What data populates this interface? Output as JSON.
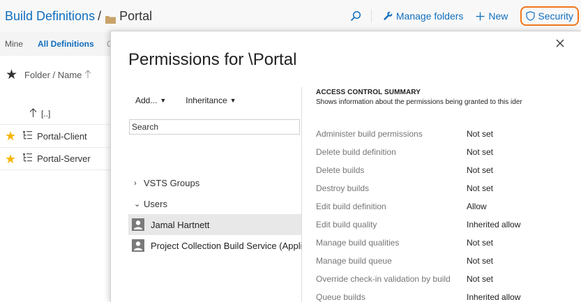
{
  "breadcrumb": {
    "root": "Build Definitions",
    "separator": "/",
    "current": "Portal"
  },
  "top_actions": {
    "manage_folders": "Manage folders",
    "new": "New",
    "security": "Security"
  },
  "tabs": {
    "mine": "Mine",
    "all_definitions": "All Definitions",
    "more": "C"
  },
  "list": {
    "column_header": "Folder / Name",
    "parent_row": "[..]",
    "definitions": [
      "Portal-Client",
      "Portal-Server"
    ]
  },
  "dialog": {
    "title": "Permissions for \\Portal",
    "toolbar": {
      "add": "Add...",
      "inheritance": "Inheritance"
    },
    "search_value": "Search",
    "groups": {
      "vsts_groups": "VSTS Groups",
      "users": "Users"
    },
    "users": [
      "Jamal Hartnett",
      "Project Collection Build Service (Appli"
    ],
    "summary": {
      "title": "ACCESS CONTROL SUMMARY",
      "description": "Shows information about the permissions being granted to this ider"
    },
    "permissions": [
      {
        "name": "Administer build permissions",
        "value": "Not set"
      },
      {
        "name": "Delete build definition",
        "value": "Not set"
      },
      {
        "name": "Delete builds",
        "value": "Not set"
      },
      {
        "name": "Destroy builds",
        "value": "Not set"
      },
      {
        "name": "Edit build definition",
        "value": "Allow"
      },
      {
        "name": "Edit build quality",
        "value": "Inherited allow"
      },
      {
        "name": "Manage build qualities",
        "value": "Not set"
      },
      {
        "name": "Manage build queue",
        "value": "Not set"
      },
      {
        "name": "Override check-in validation by build",
        "value": "Not set"
      },
      {
        "name": "Queue builds",
        "value": "Inherited allow"
      }
    ]
  },
  "colors": {
    "link": "#106ebe",
    "highlight": "#f0761d",
    "star": "#f7b500",
    "folder": "#c8a26a"
  }
}
